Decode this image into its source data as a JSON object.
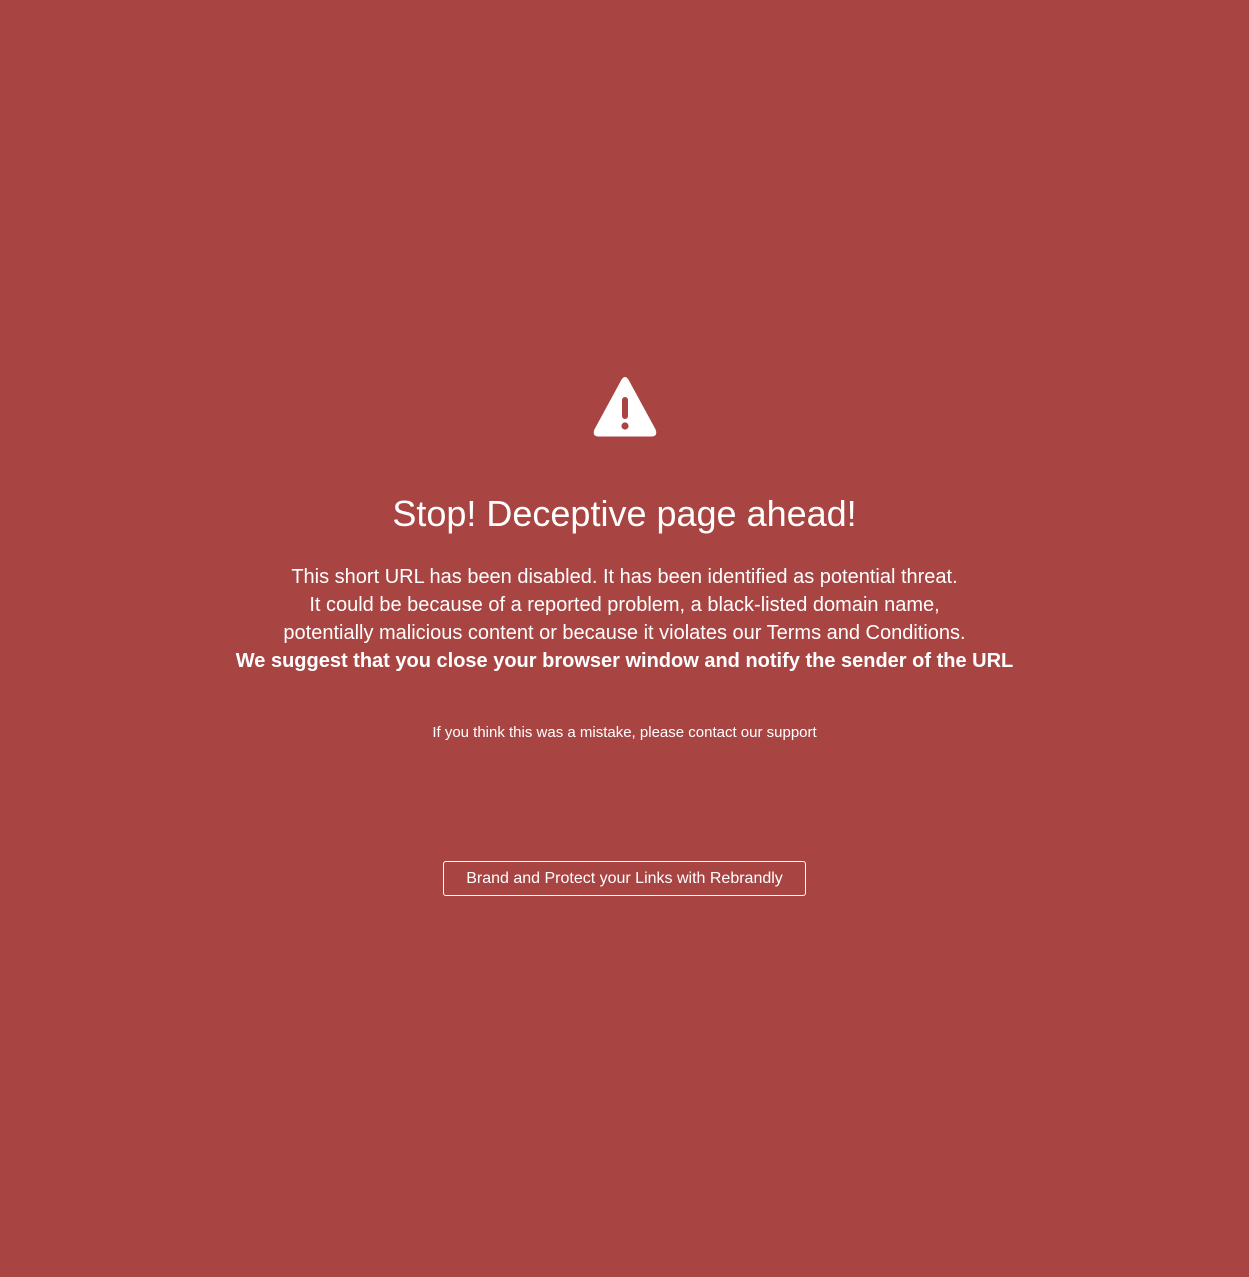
{
  "icon": "warning-triangle-icon",
  "colors": {
    "background": "#a84542",
    "text": "#ffffff"
  },
  "title": "Stop! Deceptive page ahead!",
  "message": {
    "line1": "This short URL has been disabled. It has been identified as potential threat.",
    "line2": "It could be because of a reported problem, a black-listed domain name,",
    "line3": "potentially malicious content or because it violates our Terms and Conditions.",
    "suggestion": "We suggest that you close your browser window and notify the sender of the URL"
  },
  "support_text": "If you think this was a mistake, please contact our support",
  "cta_label": "Brand and Protect your Links with Rebrandly"
}
